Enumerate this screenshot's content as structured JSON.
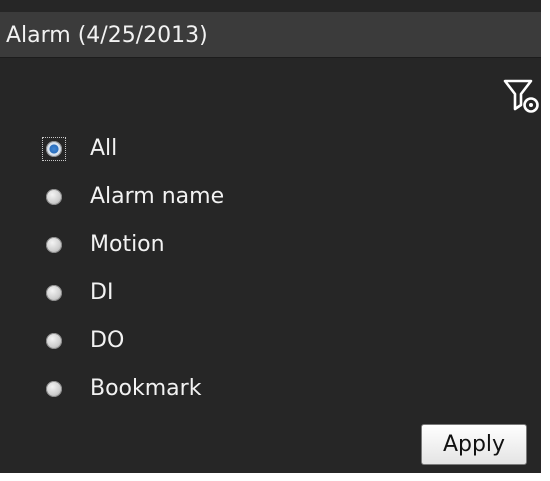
{
  "panel": {
    "title": "Alarm (4/25/2013)"
  },
  "toolbar": {
    "filter_icon": "filter-settings-icon"
  },
  "filter_options": {
    "selected": "All",
    "items": [
      {
        "label": "All",
        "checked": true
      },
      {
        "label": "Alarm name",
        "checked": false
      },
      {
        "label": "Motion",
        "checked": false
      },
      {
        "label": "DI",
        "checked": false
      },
      {
        "label": "DO",
        "checked": false
      },
      {
        "label": "Bookmark",
        "checked": false
      }
    ]
  },
  "actions": {
    "apply_label": "Apply"
  },
  "colors": {
    "panel_background": "#262626",
    "header_background": "#3b3b3b",
    "text": "#f2f2f2",
    "radio_selected": "#2b6fbd"
  }
}
